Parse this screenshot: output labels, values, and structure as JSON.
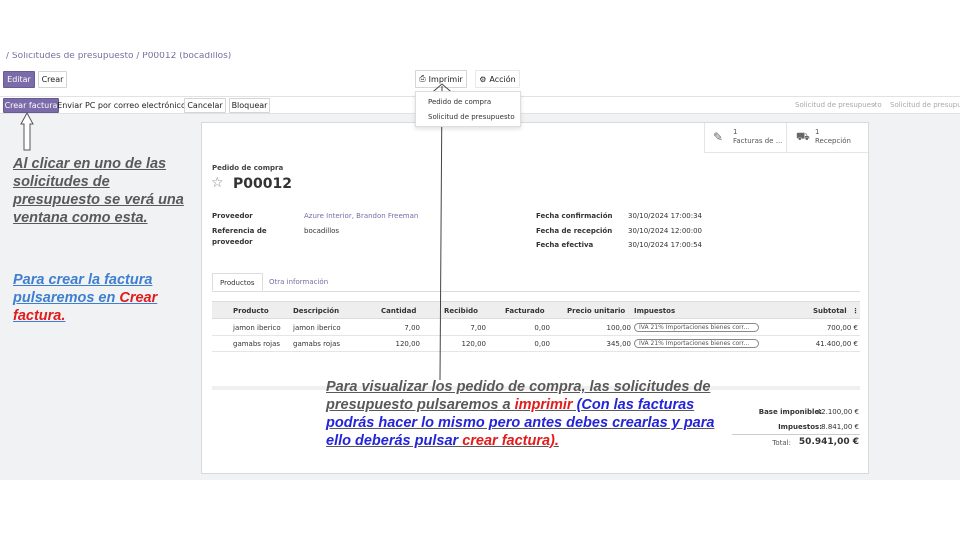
{
  "breadcrumb": "/ Solicitudes de presupuesto / P00012 (bocadillos)",
  "control_panel": {
    "edit_label": "Editar",
    "create_label": "Crear",
    "print_label": "Imprimir",
    "action_label": "Acción"
  },
  "print_menu": [
    "Pedido de compra",
    "Solicitud de presupuesto"
  ],
  "header_buttons": {
    "create_invoice": "Crear factura",
    "send_po_email": "Enviar PC por correo electrónico",
    "cancel": "Cancelar",
    "lock": "Bloquear"
  },
  "status_steps": [
    "Solicitud de presupuesto",
    "Solicitud de presupu"
  ],
  "smart_buttons": [
    {
      "count": "1",
      "label": "Facturas de ...",
      "icon": "edit-icon"
    },
    {
      "count": "1",
      "label": "Recepción",
      "icon": "truck-icon"
    }
  ],
  "record": {
    "doc_type": "Pedido de compra",
    "name": "P00012"
  },
  "fields_left": {
    "vendor_label": "Proveedor",
    "vendor_value": "Azure Interior, Brandon Freeman",
    "ref_label_1": "Referencia de",
    "ref_label_2": "proveedor",
    "ref_value": "bocadillos"
  },
  "fields_right": [
    {
      "label": "Fecha confirmación",
      "value": "30/10/2024 17:00:34"
    },
    {
      "label": "Fecha de recepción",
      "value": "30/10/2024 12:00:00"
    },
    {
      "label": "Fecha efectiva",
      "value": "30/10/2024 17:00:54"
    }
  ],
  "tabs": [
    "Productos",
    "Otra información"
  ],
  "table": {
    "headers": [
      "Producto",
      "Descripción",
      "Cantidad",
      "Recibido",
      "Facturado",
      "Precio unitario",
      "Impuestos",
      "Subtotal"
    ],
    "rows": [
      {
        "product": "jamon iberico",
        "description": "jamon iberico",
        "qty": "7,00",
        "received": "7,00",
        "invoiced": "0,00",
        "price": "100,00",
        "tax": "IVA 21% Importaciones bienes corr...",
        "subtotal": "700,00 €"
      },
      {
        "product": "gamabs rojas",
        "description": "gamabs rojas",
        "qty": "120,00",
        "received": "120,00",
        "invoiced": "0,00",
        "price": "345,00",
        "tax": "IVA 21% Importaciones bienes corr...",
        "subtotal": "41.400,00 €"
      }
    ]
  },
  "totals": {
    "base_label": "Base imponible:",
    "base_value": "42.100,00 €",
    "tax_label": "Impuestos:",
    "tax_value": "8.841,00 €",
    "total_label": "Total:",
    "total_value": "50.941,00 €"
  },
  "notes": {
    "left_1": "Al clicar  en uno de las solicitudes  de presupuesto se verá una ventana como esta.",
    "left_2a": "Para crear la factura pulsaremos en ",
    "left_2b": "Crear factura.",
    "bottom_a": "Para visualizar  los pedido  de compra,  las solicitudes  de presupuesto pulsaremos a ",
    "bottom_b": "imprimir",
    "bottom_c": " (Con las facturas podrás hacer lo mismo pero antes debes crearlas y para ello deberás pulsar ",
    "bottom_d": "crear factura)."
  },
  "colors": {
    "primary": "#7b6ba8",
    "note_grey": "#595959",
    "note_blue": "#3f7fd0",
    "note_red": "#e21b1b",
    "note_dark_blue": "#2424d8"
  }
}
